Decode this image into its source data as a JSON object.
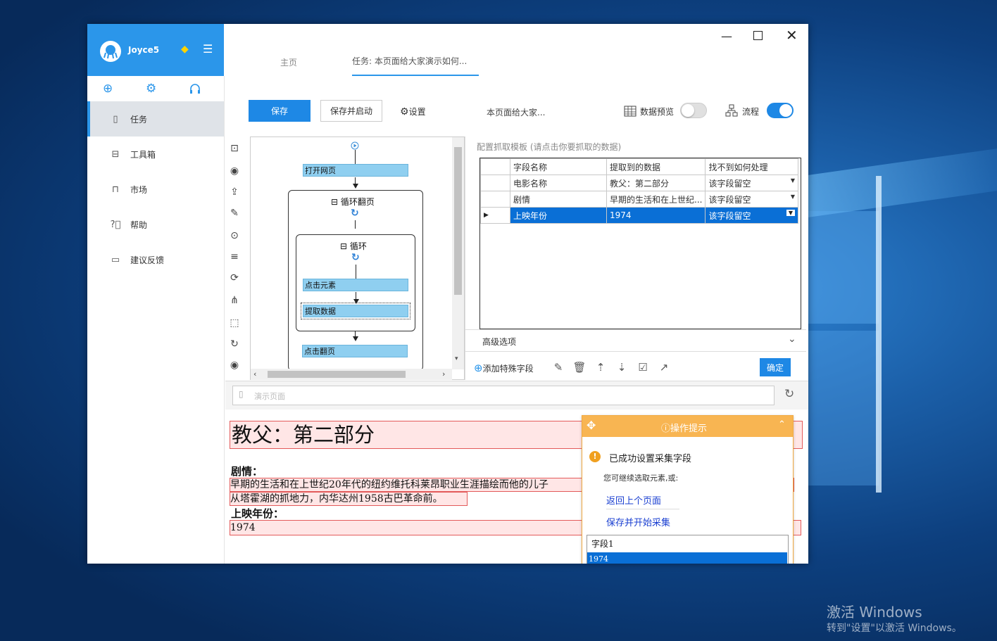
{
  "app": {
    "username": "Joyce5"
  },
  "sidebar": {
    "items": [
      {
        "label": "任务",
        "icon": "document-icon"
      },
      {
        "label": "工具箱",
        "icon": "toolbox-icon"
      },
      {
        "label": "市场",
        "icon": "bag-icon"
      },
      {
        "label": "帮助",
        "icon": "help-icon"
      },
      {
        "label": "建议反馈",
        "icon": "feedback-icon"
      }
    ]
  },
  "tabs": [
    {
      "label": "主页"
    },
    {
      "label": "任务: 本页面给大家演示如何..."
    }
  ],
  "toolbar": {
    "save_label": "保存",
    "save_start_label": "保存并启动",
    "settings_label": "设置",
    "task_name": "本页面给大家...",
    "data_preview_label": "数据预览",
    "flow_label": "流程",
    "data_preview_on": false,
    "flow_on": true
  },
  "flow": {
    "start_icon": "play-icon",
    "open_page": "打开网页",
    "loop_page": "循环翻页",
    "loop": "循环",
    "click_element": "点击元素",
    "extract_data": "提取数据",
    "click_next": "点击翻页"
  },
  "config": {
    "title": "配置抓取模板 (请点击你要抓取的数据)",
    "columns": [
      "字段名称",
      "提取到的数据",
      "找不到如何处理"
    ],
    "rows": [
      {
        "name": "电影名称",
        "data": "教父：第二部分",
        "handling": "该字段留空"
      },
      {
        "name": "剧情",
        "data": "早期的生活和在上世纪...",
        "handling": "该字段留空"
      },
      {
        "name": "上映年份",
        "data": "1974",
        "handling": "该字段留空"
      }
    ],
    "advanced_label": "高级选项",
    "add_field_label": "添加特殊字段",
    "confirm_label": "确定"
  },
  "browser": {
    "url_placeholder": "演示页面"
  },
  "page": {
    "title": "教父：第二部分",
    "plot_label": "剧情：",
    "plot_line1": "早期的生活和在上世纪20年代的纽约维托科莱昂职业生涯描绘而他的儿子",
    "plot_line2": "从塔霍湖的抓地力，内华达州1958古巴革命前。",
    "year_label": "上映年份：",
    "year_value": "1974"
  },
  "tip": {
    "header": "操作提示",
    "success": "已成功设置采集字段",
    "hint": "您可继续选取元素,或:",
    "back_link": "返回上个页面",
    "save_link": "保存并开始采集",
    "field_name": "字段1",
    "field_value": "1974"
  },
  "watermark": {
    "line1": "激活 Windows",
    "line2": "转到\"设置\"以激活 Windows。"
  },
  "colors": {
    "brand_blue": "#2b96ea",
    "button_blue": "#1e88e5",
    "selection_blue": "#0a6fd6",
    "tip_orange": "#f8b552"
  }
}
